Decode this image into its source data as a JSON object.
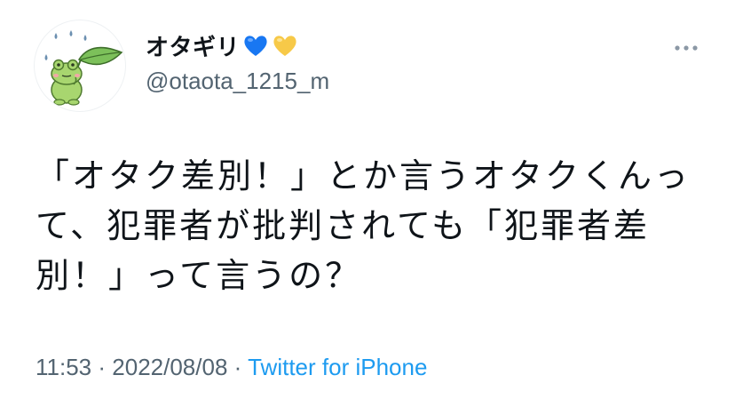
{
  "author": {
    "display_name": "オタギリ",
    "hearts": [
      "blue-heart",
      "yellow-heart"
    ],
    "handle": "@otaota_1215_m"
  },
  "tweet": {
    "text": "「オタク差別！」とか言うオタクくんって、犯罪者が批判されても「犯罪者差別！」って言うの？",
    "time": "11:53",
    "separator1": "·",
    "date": "2022/08/08",
    "separator2": "·",
    "source": "Twitter for iPhone"
  },
  "icons": {
    "more": "more-options-icon",
    "avatar": "frog-leaf-avatar"
  },
  "colors": {
    "link": "#1d9bf0",
    "secondary_text": "#536471",
    "blue_heart": "#1877f2",
    "yellow_heart": "#f7c948"
  }
}
